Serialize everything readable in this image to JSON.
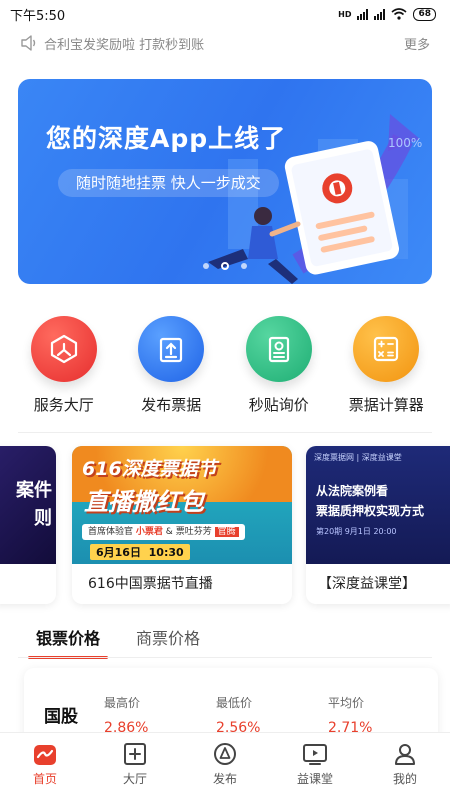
{
  "status_bar": {
    "time": "下午5:50",
    "network": "HD",
    "battery": "68"
  },
  "notice": {
    "text": "合利宝发奖励啦 打款秒到账",
    "more": "更多"
  },
  "banner": {
    "title": "您的深度App上线了",
    "subtitle": "随时随地挂票  快人一步成交",
    "badge": "100%",
    "slide_count": 3,
    "active_slide": 2
  },
  "quick_entries": [
    {
      "label": "服务大厅",
      "icon": "hall-icon",
      "color": "#ec3a3a"
    },
    {
      "label": "发布票据",
      "icon": "publish-icon",
      "color": "#2f78f0"
    },
    {
      "label": "秒贴询价",
      "icon": "inquiry-icon",
      "color": "#27b883"
    },
    {
      "label": "票据计算器",
      "icon": "calculator-icon",
      "color": "#f7a21d"
    }
  ],
  "cards": {
    "left_partial": {
      "line1": "案件",
      "line2": "则"
    },
    "center": {
      "img_line1": "616深度票据节",
      "img_line2": "直播撒红包",
      "img_host": "首席体验官",
      "img_guest1": "小票君",
      "img_amp": "&",
      "img_guest2": "票吐芬芳",
      "img_join": "官腾",
      "img_date": "6月16日",
      "img_time": "10:30",
      "title": "616中国票据节直播"
    },
    "right": {
      "brand1": "深度票据网",
      "brand2": "深度益课堂",
      "img_line1": "从法院案例看",
      "img_line2": "票据质押权实现方式",
      "img_meta": "第20期  9月1日  20:00",
      "title": "【深度益课堂】"
    }
  },
  "price_tabs": {
    "tab1": "银票价格",
    "tab2": "商票价格"
  },
  "price_card": {
    "bank": "国股",
    "high_label": "最高价",
    "high_value": "2.86%",
    "low_label": "最低价",
    "low_value": "2.56%",
    "avg_label": "平均价",
    "avg_value": "2.71%"
  },
  "bottom_nav": [
    {
      "label": "首页",
      "icon": "home-icon",
      "active": true
    },
    {
      "label": "大厅",
      "icon": "hall-nav-icon"
    },
    {
      "label": "发布",
      "icon": "publish-nav-icon"
    },
    {
      "label": "益课堂",
      "icon": "classroom-icon"
    },
    {
      "label": "我的",
      "icon": "profile-icon"
    }
  ],
  "colors": {
    "accent": "#e8402d",
    "banner": "#3a86f5"
  }
}
